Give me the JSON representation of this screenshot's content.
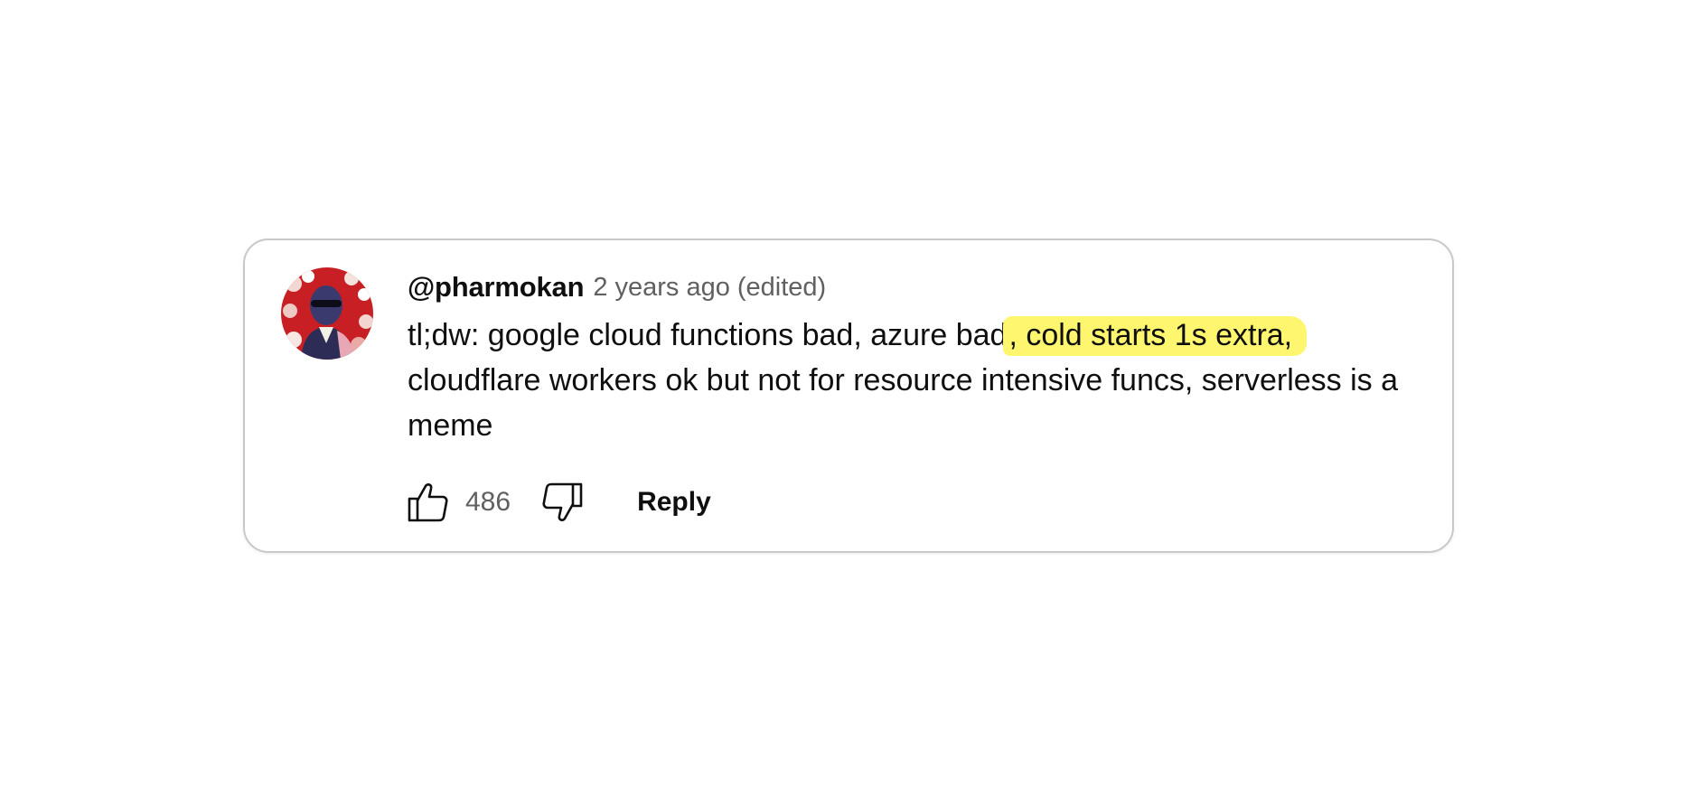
{
  "comment": {
    "author": "@pharmokan",
    "timestamp": "2 years ago",
    "edited_label": "(edited)",
    "text_before_highlight": "tl;dw: google cloud functions bad, azure bad",
    "text_highlighted": ", cold starts 1s extra,",
    "text_after_highlight": " cloudflare workers ok but not for resource intensive funcs, serverless is a meme",
    "highlight_color": "#fdf66e"
  },
  "actions": {
    "like_icon": "thumbs-up-icon",
    "like_count": "486",
    "dislike_icon": "thumbs-down-icon",
    "reply_label": "Reply"
  },
  "avatar": {
    "icon": "user-avatar-photo",
    "description_color_bg": "#c81f25"
  }
}
